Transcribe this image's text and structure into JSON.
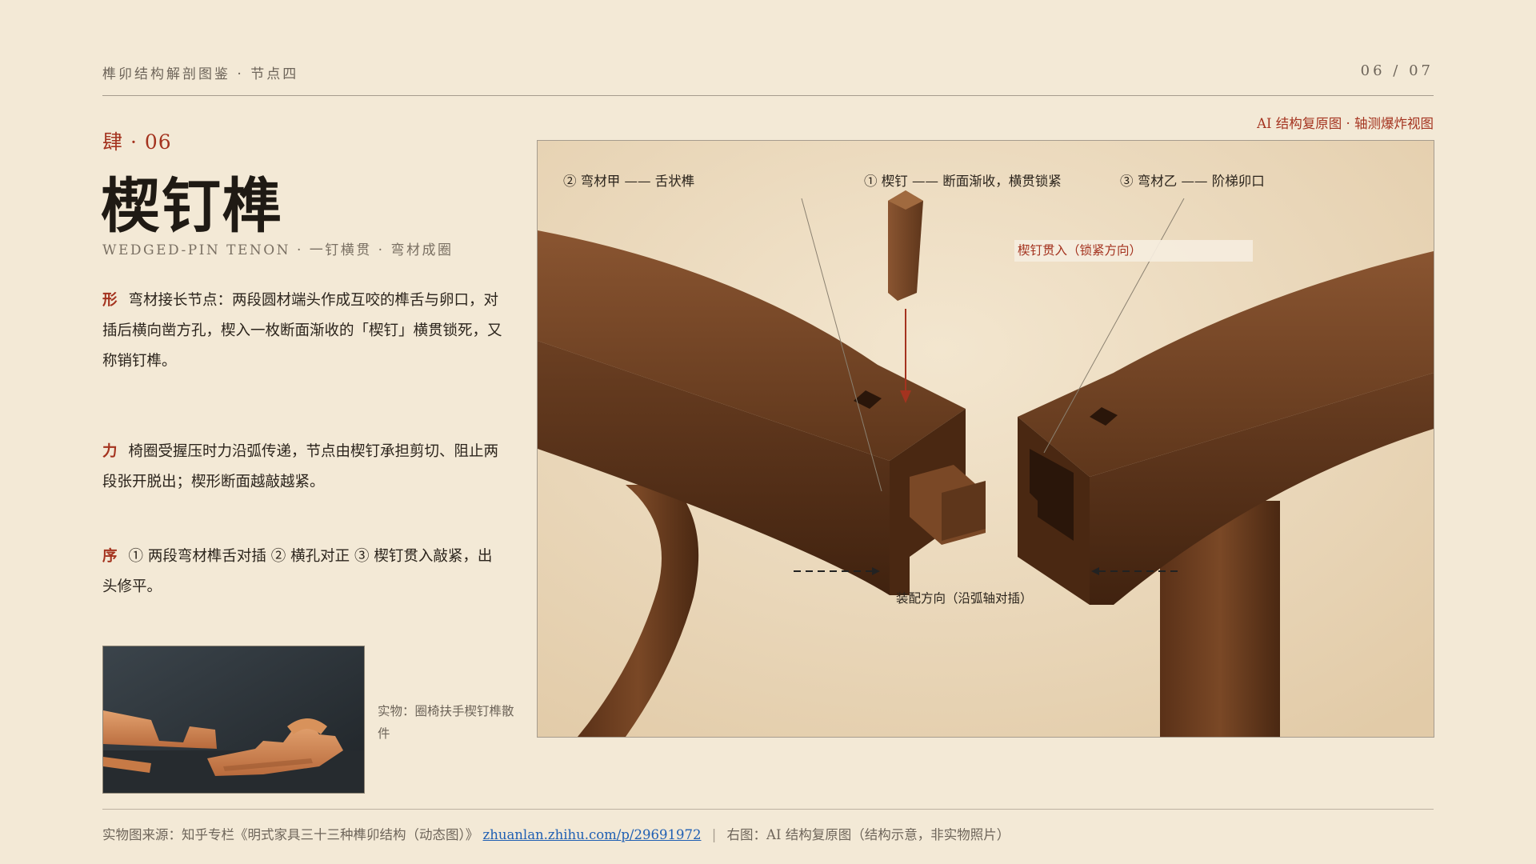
{
  "header": {
    "left": "榫卯结构解剖图鉴 · 节点四",
    "page": "06 / 07"
  },
  "section": {
    "number": "肆 · 06",
    "title": "楔钉榫",
    "subtitle": "WEDGED-PIN TENON · 一钉横贯 · 弯材成圈"
  },
  "paragraphs": [
    {
      "mark": "形",
      "text": "弯材接长节点：两段圆材端头作成互咬的榫舌与卵口，对插后横向凿方孔，楔入一枚断面渐收的「楔钉」横贯锁死，又称销钉榫。"
    },
    {
      "mark": "力",
      "text": "椅圈受握压时力沿弧传递，节点由楔钉承担剪切、阻止两段张开脱出；楔形断面越敲越紧。"
    },
    {
      "mark": "序",
      "text": "① 两段弯材榫舌对插 ② 横孔对正 ③ 楔钉贯入敲紧，出头修平。"
    }
  ],
  "photo": {
    "caption": "实物：圈椅扶手楔钉榫散件"
  },
  "diagram": {
    "tag": "AI 结构复原图 · 轴测爆炸视图",
    "labels": {
      "part_a": "② 弯材甲 —— 舌状榫",
      "pin": "① 楔钉 —— 断面渐收，横贯锁紧",
      "part_b": "③ 弯材乙 —— 阶梯卯口",
      "insert": "楔钉贯入（锁紧方向）",
      "assembly": "装配方向（沿弧轴对插）"
    }
  },
  "footer": {
    "source_prefix": "实物图来源：知乎专栏《明式家具三十三种榫卯结构（动态图）》",
    "link": "zhuanlan.zhihu.com/p/29691972",
    "separator": "|",
    "note": "右图：AI 结构复原图（结构示意，非实物照片）"
  },
  "colors": {
    "background": "#f3e9d6",
    "accent": "#a4331f",
    "wood": "#6b3f22",
    "link": "#1f5fb3"
  }
}
